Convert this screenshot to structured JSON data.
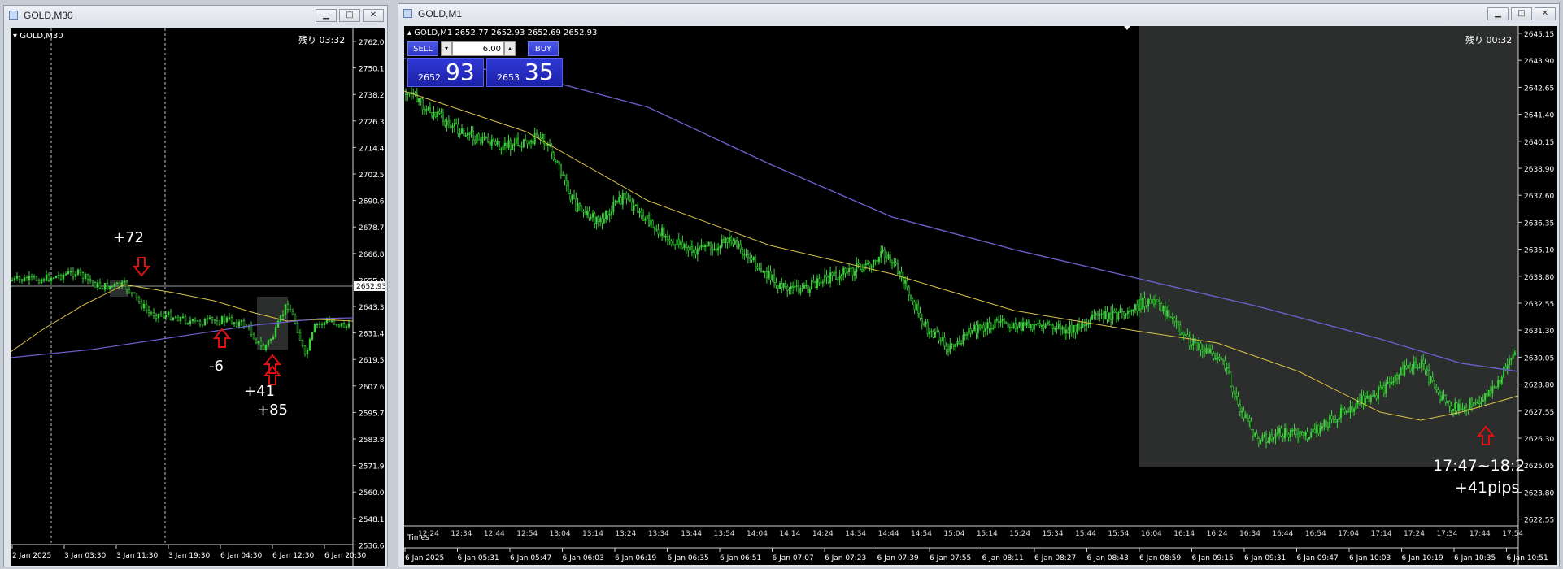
{
  "left_window": {
    "title": "GOLD,M30",
    "chart_header": "GOLD,M30",
    "countdown": "残り 03:32",
    "current_price": "2652.93",
    "y_ticks": [
      "2762.04",
      "2750.14",
      "2738.24",
      "2726.34",
      "2714.44",
      "2702.54",
      "2690.64",
      "2678.74",
      "2666.84",
      "2655.04",
      "2643.39",
      "2631.49",
      "2619.59",
      "2607.69",
      "2595.79",
      "2583.89",
      "2571.99",
      "2560.09",
      "2548.19",
      "2536.64"
    ],
    "x_ticks": [
      "2 Jan 2025",
      "3 Jan 03:30",
      "3 Jan 11:30",
      "3 Jan 19:30",
      "6 Jan 04:30",
      "6 Jan 12:30",
      "6 Jan 20:30"
    ],
    "annotations": [
      "+72",
      "-6",
      "+41",
      "+85"
    ]
  },
  "right_window": {
    "title": "GOLD,M1",
    "chart_header": "GOLD,M1  2652.77 2652.93 2652.69 2652.93",
    "countdown": "残り 00:32",
    "trade_panel": {
      "sell_label": "SELL",
      "buy_label": "BUY",
      "lot": "6.00",
      "sell_small": "2652",
      "sell_big": "93",
      "buy_small": "2653",
      "buy_big": "35"
    },
    "y_ticks": [
      "2645.15",
      "2643.90",
      "2642.65",
      "2641.40",
      "2640.15",
      "2638.90",
      "2637.60",
      "2636.35",
      "2635.10",
      "2633.80",
      "2632.55",
      "2631.30",
      "2630.05",
      "2628.80",
      "2627.55",
      "2626.30",
      "2625.05",
      "2623.80",
      "2622.55"
    ],
    "time_label": "Times",
    "time_ticks": [
      "12:24",
      "12:34",
      "12:44",
      "12:54",
      "13:04",
      "13:14",
      "13:24",
      "13:34",
      "13:44",
      "13:54",
      "14:04",
      "14:14",
      "14:24",
      "14:34",
      "14:44",
      "14:54",
      "15:04",
      "15:14",
      "15:24",
      "15:34",
      "15:44",
      "15:54",
      "16:04",
      "16:14",
      "16:24",
      "16:34",
      "16:44",
      "16:54",
      "17:04",
      "17:14",
      "17:24",
      "17:34",
      "17:44",
      "17:54"
    ],
    "x_ticks": [
      "6 Jan 2025",
      "6 Jan 05:31",
      "6 Jan 05:47",
      "6 Jan 06:03",
      "6 Jan 06:19",
      "6 Jan 06:35",
      "6 Jan 06:51",
      "6 Jan 07:07",
      "6 Jan 07:23",
      "6 Jan 07:39",
      "6 Jan 07:55",
      "6 Jan 08:11",
      "6 Jan 08:27",
      "6 Jan 08:43",
      "6 Jan 08:59",
      "6 Jan 09:15",
      "6 Jan 09:31",
      "6 Jan 09:47",
      "6 Jan 10:03",
      "6 Jan 10:19",
      "6 Jan 10:35",
      "6 Jan 10:51"
    ],
    "annotation_time": "17:47~18:2",
    "annotation_pips": "+41pips"
  },
  "colors": {
    "candle": "#3cd23c",
    "ma_fast": "#d8c44a",
    "ma_slow": "#6a5fc9",
    "highlight": "#2b2e2c",
    "arrow": "#e01010"
  }
}
